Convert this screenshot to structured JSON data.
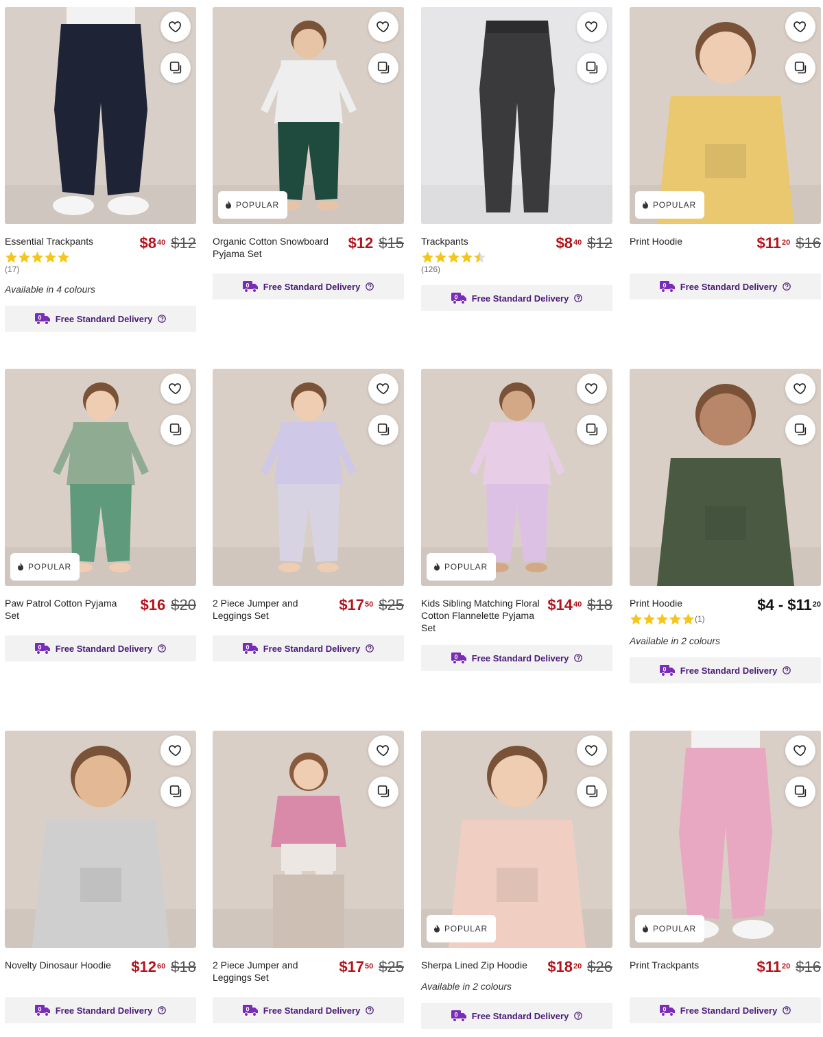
{
  "products": [
    {
      "name": "Essential Trackpants",
      "price_dollars": "$8",
      "price_cents": "40",
      "was": "$12",
      "rating": 5,
      "rating_count": "(17)",
      "availability": "Available in 4 colours",
      "popular": "",
      "delivery": "Free Standard Delivery",
      "bg": "#d8cfc8",
      "garment": "#1f2336",
      "garment2": "#1f2336",
      "skin": "#e8c4a6",
      "kind": "pants-kid"
    },
    {
      "name": "Organic Cotton Snowboard Pyjama Set",
      "price_dollars": "$12",
      "price_cents": "",
      "was": "$15",
      "rating": null,
      "rating_count": "",
      "availability": "",
      "popular": "POPULAR",
      "delivery": "Free Standard Delivery",
      "bg": "#d9cfc6",
      "garment": "#eeeeee",
      "garment2": "#1f4b3e",
      "skin": "#e8c4a6",
      "kind": "kid"
    },
    {
      "name": "Trackpants",
      "price_dollars": "$8",
      "price_cents": "40",
      "was": "$12",
      "rating": 4.5,
      "rating_count": "(126)",
      "availability": "",
      "popular": "",
      "delivery": "Free Standard Delivery",
      "bg": "#e6e6e9",
      "garment": "#3a3a3c",
      "garment2": "#3a3a3c",
      "skin": "#e6e6e9",
      "kind": "pants-flat"
    },
    {
      "name": "Print Hoodie",
      "price_dollars": "$11",
      "price_cents": "20",
      "was": "$16",
      "rating": null,
      "rating_count": "",
      "availability": "",
      "popular": "POPULAR",
      "delivery": "Free Standard Delivery",
      "bg": "#d9cfc6",
      "garment": "#e9c870",
      "garment2": "#2b2b2b",
      "skin": "#efcdb2",
      "kind": "kid-top"
    },
    {
      "name": "Paw Patrol Cotton Pyjama Set",
      "price_dollars": "$16",
      "price_cents": "",
      "was": "$20",
      "rating": null,
      "rating_count": "",
      "availability": "",
      "popular": "POPULAR",
      "delivery": "Free Standard Delivery",
      "bg": "#d9cfc6",
      "garment": "#8fab92",
      "garment2": "#5f9a7c",
      "skin": "#efcdb2",
      "kind": "kid"
    },
    {
      "name": "2 Piece Jumper and Leggings Set",
      "price_dollars": "$17",
      "price_cents": "50",
      "was": "$25",
      "rating": null,
      "rating_count": "",
      "availability": "",
      "popular": "",
      "delivery": "Free Standard Delivery",
      "bg": "#d9cfc6",
      "garment": "#cfc8e6",
      "garment2": "#d7d3e2",
      "skin": "#efcdb2",
      "kind": "kid"
    },
    {
      "name": "Kids Sibling Matching Floral Cotton Flannelette Pyjama Set",
      "price_dollars": "$14",
      "price_cents": "40",
      "was": "$18",
      "rating": null,
      "rating_count": "",
      "availability": "",
      "popular": "POPULAR",
      "delivery": "Free Standard Delivery",
      "bg": "#d9cfc6",
      "garment": "#e8cde6",
      "garment2": "#dcc1e4",
      "skin": "#d2a886",
      "kind": "kid"
    },
    {
      "name": "Print Hoodie",
      "price_dollars": "",
      "price_cents": "",
      "was": "",
      "range_from": "$4 - $11",
      "range_cents": "20",
      "rating": 5,
      "rating_count": "(1)",
      "availability": "Available in 2 colours",
      "popular": "",
      "delivery": "Free Standard Delivery",
      "bg": "#d9cfc6",
      "garment": "#4a5a42",
      "garment2": "#3b3b3b",
      "skin": "#b8876a",
      "kind": "kid-top"
    },
    {
      "name": "Novelty Dinosaur Hoodie",
      "price_dollars": "$12",
      "price_cents": "60",
      "was": "$18",
      "rating": null,
      "rating_count": "",
      "availability": "",
      "popular": "",
      "delivery": "Free Standard Delivery",
      "bg": "#d9cfc6",
      "garment": "#cfcfcf",
      "garment2": "#222630",
      "skin": "#e3b894",
      "kind": "kid-top"
    },
    {
      "name": "2 Piece Jumper and Leggings Set",
      "price_dollars": "$17",
      "price_cents": "50",
      "was": "$25",
      "rating": null,
      "rating_count": "",
      "availability": "",
      "popular": "",
      "delivery": "Free Standard Delivery",
      "bg": "#d9cfc6",
      "garment": "#d98aa8",
      "garment2": "#ece7e3",
      "skin": "#efcdb2",
      "kind": "kid-sit"
    },
    {
      "name": "Sherpa Lined Zip Hoodie",
      "price_dollars": "$18",
      "price_cents": "20",
      "was": "$26",
      "rating": null,
      "rating_count": "",
      "availability": "Available in 2 colours",
      "popular": "POPULAR",
      "delivery": "Free Standard Delivery",
      "bg": "#d9cfc6",
      "garment": "#f0cfc2",
      "garment2": "#b9cfe0",
      "skin": "#efcdb2",
      "kind": "kid-top"
    },
    {
      "name": "Print Trackpants",
      "price_dollars": "$11",
      "price_cents": "20",
      "was": "$16",
      "rating": null,
      "rating_count": "",
      "availability": "",
      "popular": "POPULAR",
      "delivery": "Free Standard Delivery",
      "bg": "#d9cfc6",
      "garment": "#e8a8c2",
      "garment2": "#e8a8c2",
      "skin": "#efcdb2",
      "kind": "pants-kid"
    }
  ],
  "colors": {
    "sale": "#b5121b",
    "delivery_text": "#4b1b78",
    "delivery_bg": "#f2f2f2",
    "star": "#f5c518"
  },
  "icons": {
    "favourite": "heart-icon",
    "compare": "compare-icon",
    "popular": "flame-icon",
    "delivery": "truck-icon",
    "help": "help-circle-icon"
  }
}
